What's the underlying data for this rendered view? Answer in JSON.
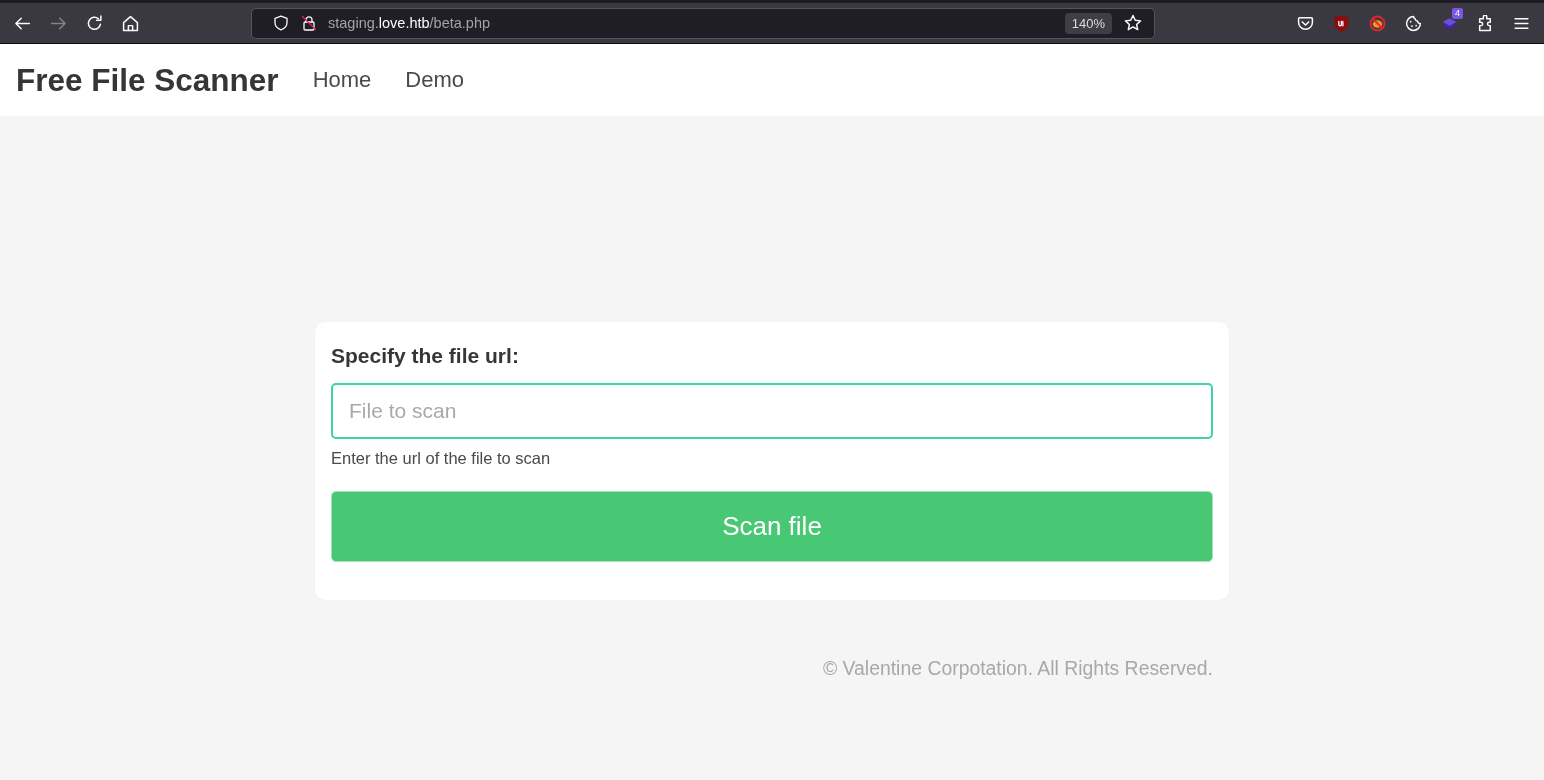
{
  "browser": {
    "nav_buttons": [
      {
        "kind": "back",
        "disabled": false
      },
      {
        "kind": "forward",
        "disabled": true
      },
      {
        "kind": "reload",
        "disabled": false
      },
      {
        "kind": "home",
        "disabled": false
      }
    ],
    "address": {
      "subdomain": "staging.",
      "domain": "love.htb",
      "path": "/beta.php",
      "zoom": "140%"
    },
    "extension_badge": "4"
  },
  "navbar": {
    "brand": "Free File Scanner",
    "links": [
      "Home",
      "Demo"
    ]
  },
  "form": {
    "label": "Specify the file url:",
    "field": {
      "placeholder": "File to scan",
      "focused": true
    },
    "help": "Enter the url of the file to scan",
    "button": "Scan file"
  },
  "footer": "© Valentine Corpotation. All Rights Reserved."
}
